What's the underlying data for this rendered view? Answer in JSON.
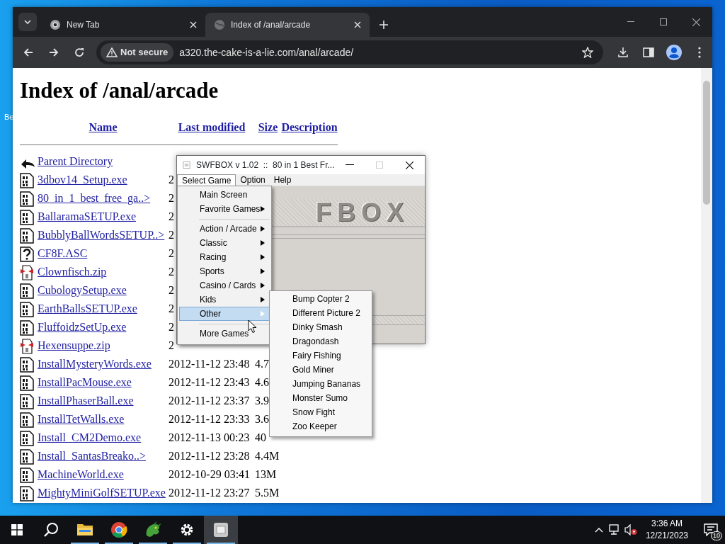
{
  "desktop": {
    "icon_label": "Be"
  },
  "browser": {
    "tabs": [
      {
        "title": "New Tab",
        "selected": false
      },
      {
        "title": "Index of /anal/arcade",
        "selected": true
      }
    ],
    "security": "Not secure",
    "url": "a320.the-cake-is-a-lie.com/anal/arcade/"
  },
  "page": {
    "heading": "Index of /anal/arcade",
    "columns": [
      "Name",
      "Last modified",
      "Size",
      "Description"
    ],
    "rows": [
      {
        "kind": "back",
        "name": "Parent Directory"
      },
      {
        "kind": "binary",
        "name": "3dbov14_Setup.exe",
        "modified": "2"
      },
      {
        "kind": "binary",
        "name": "80_in_1_best_free_ga..>",
        "modified": "2"
      },
      {
        "kind": "binary",
        "name": "BallaramaSETUP.exe",
        "modified": "2"
      },
      {
        "kind": "binary",
        "name": "BubblyBallWordsSETUP..>",
        "modified": "2"
      },
      {
        "kind": "unknown",
        "name": "CF8F.ASC",
        "modified": "2"
      },
      {
        "kind": "compressed",
        "name": "Clownfisch.zip",
        "modified": "2"
      },
      {
        "kind": "binary",
        "name": "CubologySetup.exe",
        "modified": "2"
      },
      {
        "kind": "binary",
        "name": "EarthBallsSETUP.exe",
        "modified": "2"
      },
      {
        "kind": "binary",
        "name": "FluffoidzSetUp.exe",
        "modified": "2"
      },
      {
        "kind": "compressed",
        "name": "Hexensuppe.zip",
        "modified": "2"
      },
      {
        "kind": "binary",
        "name": "InstallMysteryWords.exe",
        "modified": "2012-11-12 23:48",
        "size": "4.7"
      },
      {
        "kind": "binary",
        "name": "InstallPacMouse.exe",
        "modified": "2012-11-12 23:43",
        "size": "4.6"
      },
      {
        "kind": "binary",
        "name": "InstallPhaserBall.exe",
        "modified": "2012-11-12 23:37",
        "size": "3.9"
      },
      {
        "kind": "binary",
        "name": "InstallTetWalls.exe",
        "modified": "2012-11-12 23:33",
        "size": "3.6"
      },
      {
        "kind": "binary",
        "name": "Install_CM2Demo.exe",
        "modified": "2012-11-13 00:23",
        "size": "40"
      },
      {
        "kind": "binary",
        "name": "Install_SantasBreako..>",
        "modified": "2012-11-12 23:28",
        "size": "4.4M"
      },
      {
        "kind": "binary",
        "name": "MachineWorld.exe",
        "modified": "2012-10-29 03:41",
        "size": "13M"
      },
      {
        "kind": "binary",
        "name": "MightyMiniGolfSETUP.exe",
        "modified": "2012-11-12 23:27",
        "size": "5.5M"
      }
    ]
  },
  "app_window": {
    "title": "SWFBOX v 1.02  ::  80 in 1 Best Fr...",
    "logo": "FBOX",
    "menus": [
      {
        "label": "Select Game",
        "selected": true
      },
      {
        "label": "Option",
        "selected": false
      },
      {
        "label": "Help",
        "selected": false
      }
    ],
    "menu_items": [
      {
        "kind": "item",
        "label": "Main Screen",
        "has_submenu": false,
        "selected": false
      },
      {
        "kind": "item",
        "label": "Favorite Games",
        "has_submenu": true,
        "selected": false
      },
      {
        "kind": "separator"
      },
      {
        "kind": "item",
        "label": "Action / Arcade",
        "has_submenu": true,
        "selected": false
      },
      {
        "kind": "item",
        "label": "Classic",
        "has_submenu": true,
        "selected": false
      },
      {
        "kind": "item",
        "label": "Racing",
        "has_submenu": true,
        "selected": false
      },
      {
        "kind": "item",
        "label": "Sports",
        "has_submenu": true,
        "selected": false
      },
      {
        "kind": "item",
        "label": "Casino / Cards",
        "has_submenu": true,
        "selected": false
      },
      {
        "kind": "item",
        "label": "Kids",
        "has_submenu": true,
        "selected": false
      },
      {
        "kind": "item",
        "label": "Other",
        "has_submenu": true,
        "selected": true
      },
      {
        "kind": "separator"
      },
      {
        "kind": "item",
        "label": "More Games",
        "has_submenu": false,
        "selected": false
      }
    ],
    "submenu_items": [
      "Bump Copter 2",
      "Different Picture 2",
      "Dinky Smash",
      "Dragondash",
      "Fairy Fishing",
      "Gold Miner",
      "Jumping Bananas",
      "Monster Sumo",
      "Snow Fight",
      "Zoo Keeper"
    ]
  },
  "taskbar": {
    "apps": [
      {
        "kind": "start",
        "running": false,
        "selected": false
      },
      {
        "kind": "search",
        "running": false,
        "selected": false
      },
      {
        "kind": "folder",
        "running": true,
        "selected": false
      },
      {
        "kind": "chrome",
        "running": true,
        "selected": false
      },
      {
        "kind": "dragon",
        "running": true,
        "selected": false
      },
      {
        "kind": "gear",
        "running": true,
        "selected": false
      },
      {
        "kind": "swfbox",
        "running": true,
        "selected": true
      }
    ],
    "time": "3:36 AM",
    "date": "12/21/2023",
    "notifications": "10"
  }
}
